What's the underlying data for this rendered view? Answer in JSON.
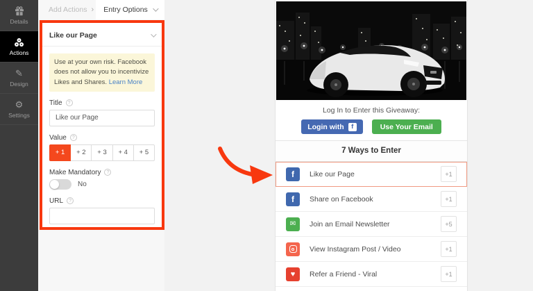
{
  "sidebar": {
    "items": [
      {
        "label": "Details",
        "icon": "gift-icon"
      },
      {
        "label": "Actions",
        "icon": "actions-cluster-icon",
        "active": true
      },
      {
        "label": "Design",
        "icon": "design-tools-icon"
      },
      {
        "label": "Settings",
        "icon": "gear-icon"
      }
    ]
  },
  "panel_header": {
    "breadcrumb": "Add Actions",
    "tab_label": "Entry Options"
  },
  "action_editor": {
    "section_title": "Like our Page",
    "warning": {
      "text": "Use at your own risk. Facebook does not allow you to incentivize Likes and Shares.",
      "link": "Learn More"
    },
    "title_field": {
      "label": "Title",
      "value": "Like our Page"
    },
    "value_field": {
      "label": "Value",
      "options": [
        "+ 1",
        "+ 2",
        "+ 3",
        "+ 4",
        "+ 5"
      ],
      "selected": "+ 1"
    },
    "mandatory_field": {
      "label": "Make Mandatory",
      "state": "No"
    },
    "url_field": {
      "label": "URL",
      "value": ""
    }
  },
  "preview": {
    "login_prompt": "Log In to Enter this Giveaway:",
    "login_facebook_label": "Login with",
    "login_email_label": "Use Your Email",
    "ways_header": "7 Ways to Enter",
    "entries": [
      {
        "label": "Like our Page",
        "value": "+1",
        "icon": "facebook-icon",
        "highlighted": true
      },
      {
        "label": "Share on Facebook",
        "value": "+1",
        "icon": "facebook-icon"
      },
      {
        "label": "Join an Email Newsletter",
        "value": "+5",
        "icon": "envelope-icon"
      },
      {
        "label": "View Instagram Post / Video",
        "value": "+1",
        "icon": "instagram-icon"
      },
      {
        "label": "Refer a Friend - Viral",
        "value": "+1",
        "icon": "heart-icon"
      }
    ]
  },
  "icons": {
    "breadcrumb_chevron": "›",
    "facebook_letter": "f",
    "envelope": "✉",
    "heart": "♥",
    "gear": "⚙",
    "design_pencil": "✎",
    "help": "?"
  },
  "colors": {
    "annotation_red": "#f8380f",
    "selected_value_orange": "#f4481d",
    "facebook_blue": "#4569b2",
    "email_green": "#4caf50",
    "instagram_coral": "#f4654d",
    "heart_red": "#e6412f",
    "warning_yellow": "#fbf6d9",
    "highlight_salmon": "#f09a82",
    "sidebar_dark": "#3c3c3c"
  }
}
